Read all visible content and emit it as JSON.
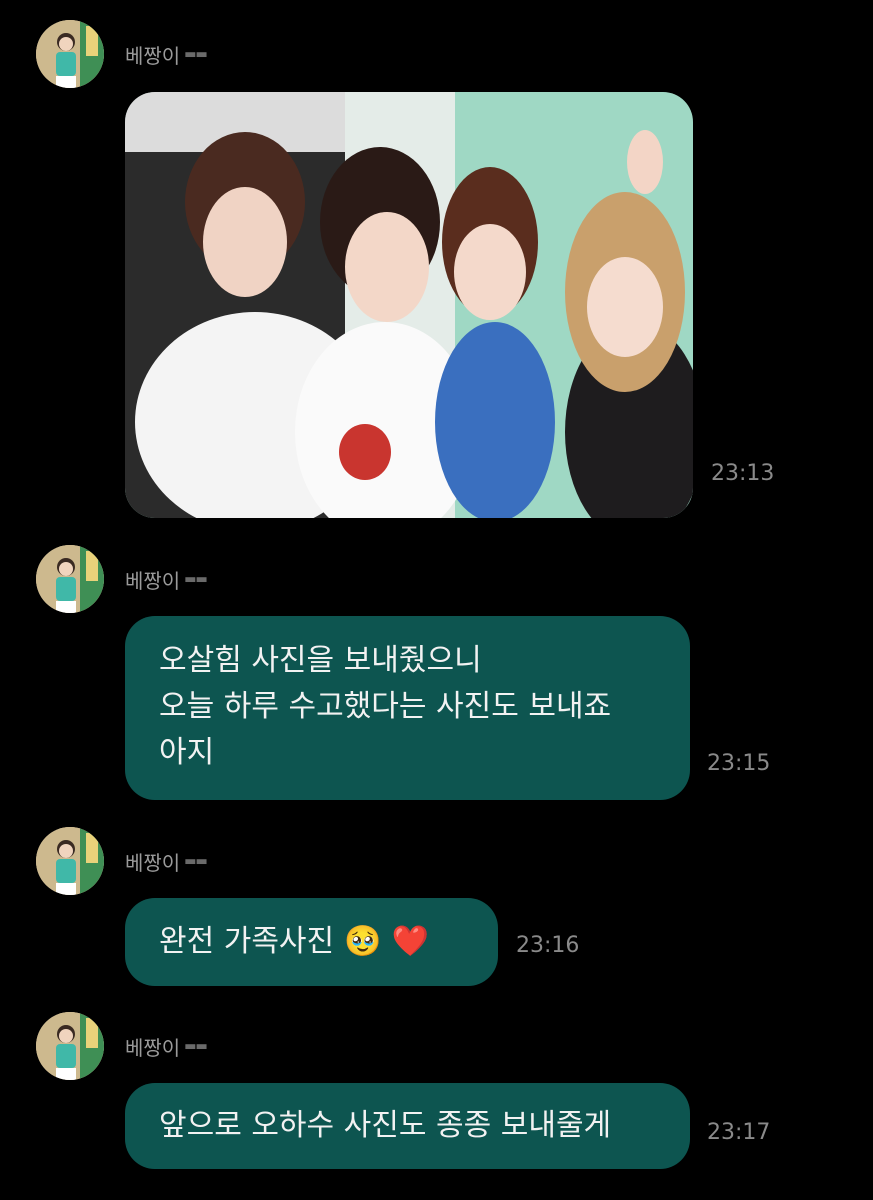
{
  "messages": [
    {
      "sender": "베짱이",
      "sender_suffix": "🕶",
      "type": "image",
      "time": "23:13"
    },
    {
      "sender": "베짱이",
      "sender_suffix": "🕶",
      "type": "text",
      "lines": [
        "오살힘 사진을 보내줬으니",
        "오늘 하루 수고했다는 사진도 보내죠",
        "아지"
      ],
      "time": "23:15"
    },
    {
      "sender": "베짱이",
      "sender_suffix": "🕶",
      "type": "text",
      "text": "완전 가족사진",
      "emojis": [
        "🥹",
        "❤️"
      ],
      "time": "23:16"
    },
    {
      "sender": "베짱이",
      "sender_suffix": "🕶",
      "type": "text",
      "text": "앞으로 오하수 사진도 종종 보내줄게",
      "time": "23:17"
    }
  ],
  "colors": {
    "background": "#000000",
    "bubble": "#0d5550",
    "sender": "#9a9a9a",
    "time": "#8a8a8a"
  }
}
